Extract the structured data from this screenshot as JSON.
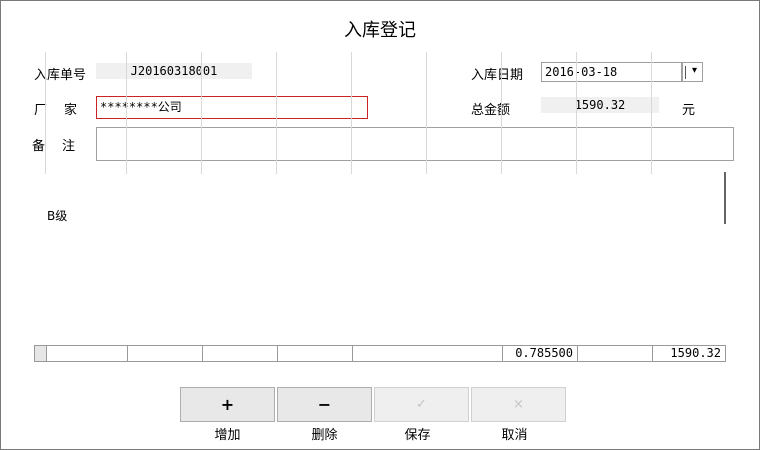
{
  "window": {
    "title": "入库登记"
  },
  "form": {
    "order_no_label": "入库单号",
    "order_no": "J20160318001",
    "date_label": "入库日期",
    "date_value": "2016-03-18",
    "vendor_label": "厂　家",
    "vendor_value": "********公司",
    "total_label": "总金额",
    "total_value": "1590.32",
    "currency": "元",
    "remark_label": "备　注",
    "remark_value": ""
  },
  "grid": {
    "header_text": "B级",
    "footer": [
      "",
      "",
      "",
      "",
      "",
      "0.785500",
      "",
      "1590.32"
    ]
  },
  "buttons": {
    "add_glyph": "+",
    "add_label": "增加",
    "delete_glyph": "−",
    "delete_label": "删除",
    "save_glyph": "✓",
    "save_label": "保存",
    "cancel_glyph": "×",
    "cancel_label": "取消"
  },
  "icons": {
    "dropdown": "chevron-down-icon"
  },
  "colors": {
    "vendor_border": "#cc2222"
  }
}
